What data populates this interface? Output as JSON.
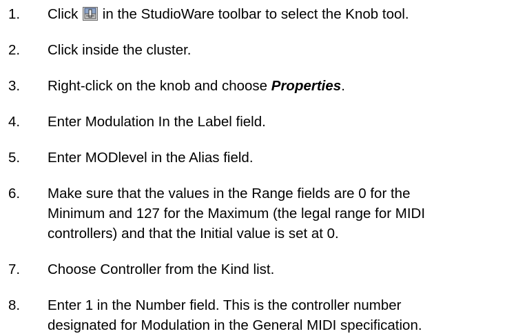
{
  "steps": [
    {
      "number": "1.",
      "text_before": "Click ",
      "icon": "knob-tool-icon",
      "text_after": " in the StudioWare toolbar to select the Knob tool."
    },
    {
      "number": "2.",
      "text": "Click inside the cluster."
    },
    {
      "number": "3.",
      "text_before": "Right-click on the knob and choose ",
      "emphasis": "Properties",
      "text_after": "."
    },
    {
      "number": "4.",
      "text": "Enter Modulation In the Label field."
    },
    {
      "number": "5.",
      "text": "Enter MODlevel in the Alias field."
    },
    {
      "number": "6.",
      "text": "Make sure that the values in the Range fields are 0 for the\nMinimum and 127 for the Maximum (the legal range for MIDI\ncontrollers) and that the Initial value is set at 0."
    },
    {
      "number": "7.",
      "text": "Choose Controller from the Kind list."
    },
    {
      "number": "8.",
      "text": "Enter 1 in the Number field. This is the controller number\ndesignated for Modulation in the General MIDI specification."
    }
  ]
}
